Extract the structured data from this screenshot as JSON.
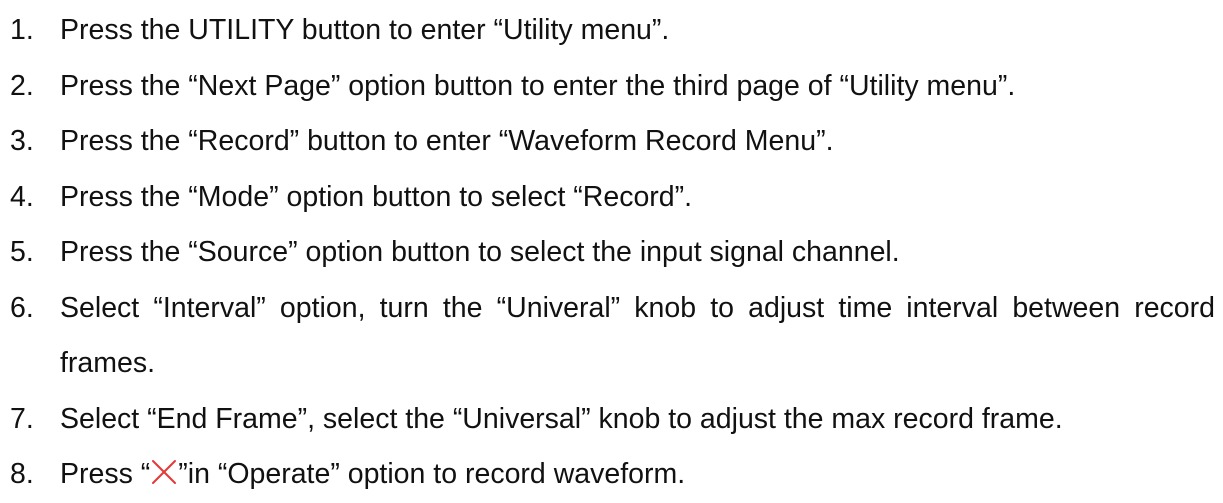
{
  "steps": [
    {
      "number": "1.",
      "text": "Press the UTILITY button to enter “Utility menu”."
    },
    {
      "number": "2.",
      "text": "Press the “Next Page” option button to enter the third page of  “Utility menu”."
    },
    {
      "number": "3.",
      "text": "Press the “Record” button to enter “Waveform Record Menu”."
    },
    {
      "number": "4.",
      "text": "Press the “Mode” option button to select “Record”."
    },
    {
      "number": "5.",
      "text": "Press the “Source” option button to select the input signal channel."
    },
    {
      "number": "6.",
      "text": "Select “Interval” option, turn the “Univeral” knob to adjust time interval between record frames."
    },
    {
      "number": "7.",
      "text": "Select “End Frame”, select the “Universal” knob to adjust the max record frame."
    },
    {
      "number": "8.",
      "text_before": "Press “",
      "icon": "record-x-icon",
      "text_after": "”in “Operate” option to record waveform."
    }
  ],
  "colors": {
    "text": "#111111",
    "icon": "#e53935"
  }
}
